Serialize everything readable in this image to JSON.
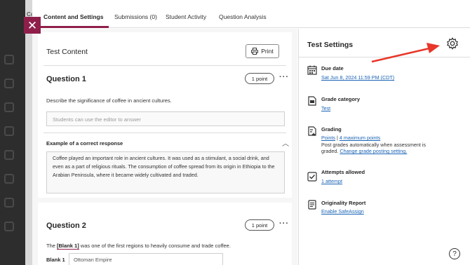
{
  "tabs": [
    {
      "label": "Content and Settings"
    },
    {
      "label": "Submissions (0)"
    },
    {
      "label": "Student Activity"
    },
    {
      "label": "Question Analysis"
    }
  ],
  "background": {
    "peek_text": "Co"
  },
  "content": {
    "title": "Test Content",
    "print_label": "Print",
    "questions": [
      {
        "title": "Question 1",
        "points": "1 point",
        "prompt": "Describe the significance of coffee in ancient cultures.",
        "answer_placeholder": "Students can use the editor to answer",
        "example_label": "Example of a correct response",
        "example_text": "Coffee played an important role in ancient cultures. It was used as a stimulant, a social drink, and even as a part of religious rituals. The consumption of coffee spread from its origin in Ethiopia to the Arabian Peninsula, where it became widely cultivated and traded."
      },
      {
        "title": "Question 2",
        "points": "1 point",
        "prompt_prefix": "The ",
        "blank_token": "[Blank 1]",
        "prompt_suffix": " was one of the first regions to heavily consume and trade coffee.",
        "blank_label": "Blank 1",
        "blank_value": "Ottoman Empire"
      }
    ]
  },
  "settings": {
    "title": "Test Settings",
    "items": [
      {
        "icon": "calendar-icon",
        "label": "Due date",
        "link": "Sat Jun 8, 2024 11:59 PM (CDT)"
      },
      {
        "icon": "grade-category-icon",
        "label": "Grade category",
        "link": "Test"
      },
      {
        "icon": "grading-icon",
        "label": "Grading",
        "link_points": "Points",
        "separator": " | ",
        "link_max": "4 maximum points",
        "note_line1": "Post grades automatically when assessment is",
        "note_line2_prefix": "graded. ",
        "link_change": "Change grade posting setting."
      },
      {
        "icon": "attempts-icon",
        "label": "Attempts allowed",
        "link": "1 attempt"
      },
      {
        "icon": "originality-icon",
        "label": "Originality Report",
        "link": "Enable SafeAssign"
      }
    ]
  },
  "colors": {
    "accent": "#8f1f4a",
    "link": "#1a64b5",
    "annotation_arrow": "#e8372a"
  }
}
